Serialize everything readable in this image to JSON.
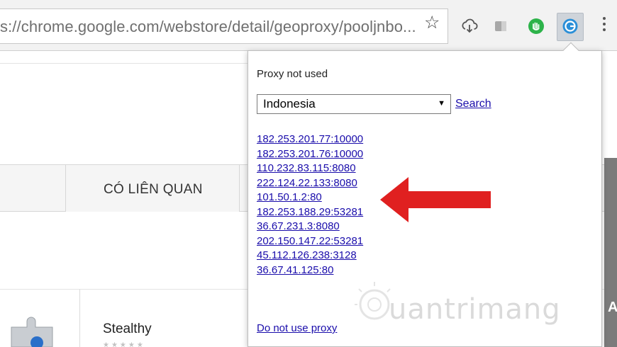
{
  "browser": {
    "url_prefix": "s://chrome.google.com",
    "url_path": "/webstore/detail/geoproxy/pooljnbo...",
    "icons": [
      "star-icon",
      "cloud-download-icon",
      "reader-icon",
      "green-hand-icon",
      "geoproxy-icon",
      "menu-dots-icon"
    ]
  },
  "page": {
    "tab_label": "CÓ LIÊN QUAN",
    "extension_name": "Stealthy",
    "rating": "★★★★★",
    "right_edge_letter": "A"
  },
  "popup": {
    "status": "Proxy not used",
    "country_select": {
      "value": "Indonesia",
      "arrow": "▼"
    },
    "search_label": "Search",
    "proxies": [
      "182.253.201.77:10000",
      "182.253.201.76:10000",
      "110.232.83.115:8080",
      "222.124.22.133:8080",
      "101.50.1.2:80",
      "182.253.188.29:53281",
      "36.67.231.3:8080",
      "202.150.147.22:53281",
      "45.112.126.238:3128",
      "36.67.41.125:80"
    ],
    "no_proxy_label": "Do not use proxy"
  },
  "watermark": "uantrimang",
  "colors": {
    "link": "#1a0dab",
    "arrow": "#e02020",
    "geoproxy_icon": "#2a8fd8",
    "green_icon": "#2db34a"
  }
}
